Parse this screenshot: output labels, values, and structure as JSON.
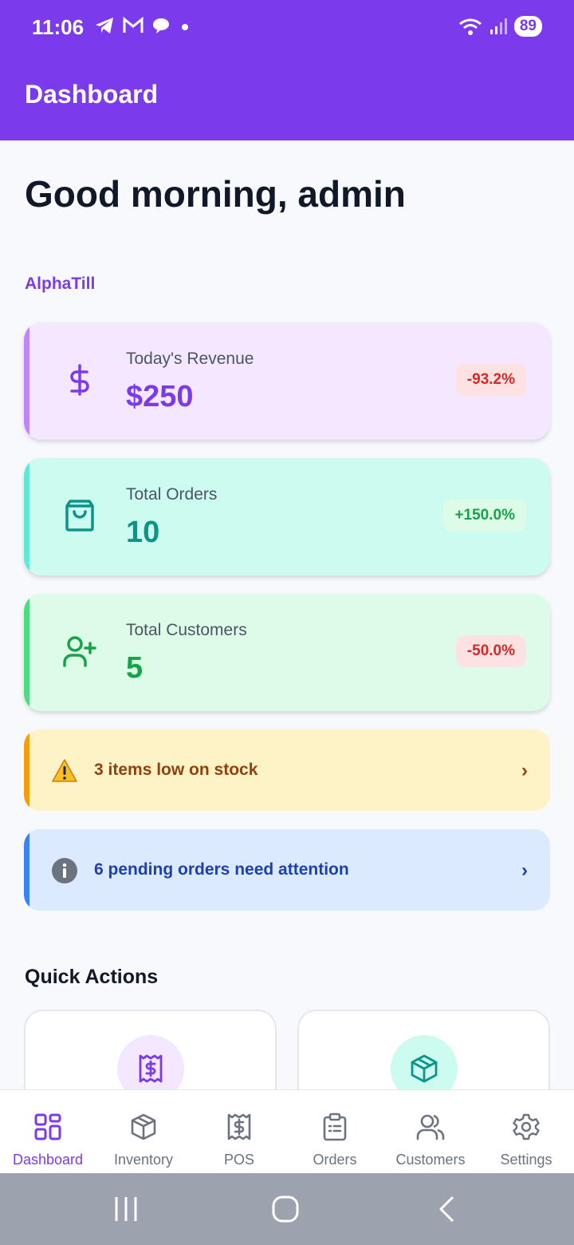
{
  "status_bar": {
    "time": "11:06",
    "battery": "89"
  },
  "app_bar": {
    "title": "Dashboard"
  },
  "greeting": {
    "line": "Good morning, admin",
    "store": "AlphaTill"
  },
  "stats": [
    {
      "label": "Today's Revenue",
      "value": "$250",
      "change": "-93.2%",
      "icon": "dollar-icon",
      "accent": "#7c3aed"
    },
    {
      "label": "Total Orders",
      "value": "10",
      "change": "+150.0%",
      "icon": "shopping-bag-icon",
      "accent": "#0d9488"
    },
    {
      "label": "Total Customers",
      "value": "5",
      "change": "-50.0%",
      "icon": "user-plus-icon",
      "accent": "#16a34a"
    }
  ],
  "alerts": [
    {
      "text": "3 items low on stock",
      "icon": "warning-icon"
    },
    {
      "text": "6 pending orders need attention",
      "icon": "info-icon"
    }
  ],
  "quick_actions": {
    "title": "Quick Actions",
    "items": [
      {
        "icon": "receipt-icon"
      },
      {
        "icon": "box-icon"
      }
    ]
  },
  "bottom_nav": [
    {
      "label": "Dashboard",
      "icon": "dashboard-icon",
      "active": true
    },
    {
      "label": "Inventory",
      "icon": "box-icon"
    },
    {
      "label": "POS",
      "icon": "receipt-icon"
    },
    {
      "label": "Orders",
      "icon": "clipboard-icon"
    },
    {
      "label": "Customers",
      "icon": "users-icon"
    },
    {
      "label": "Settings",
      "icon": "gear-icon"
    }
  ]
}
